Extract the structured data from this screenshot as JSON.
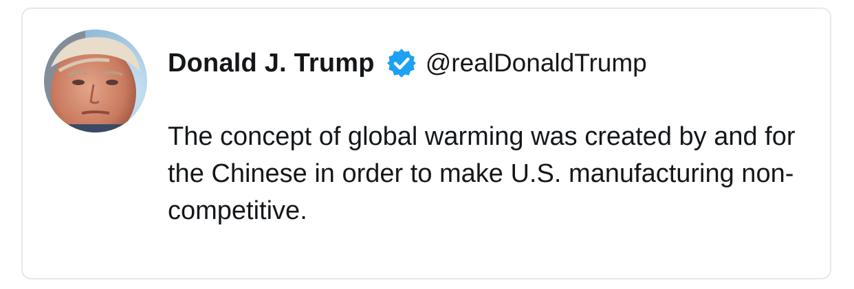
{
  "tweet": {
    "display_name": "Donald J. Trump",
    "handle": "@realDonaldTrump",
    "verified": true,
    "verified_icon": "verified-badge-icon",
    "accent_color": "#1da1f2",
    "text": "The concept of global warming was created by and for the Chinese in order to make U.S. manufacturing non-competitive."
  }
}
